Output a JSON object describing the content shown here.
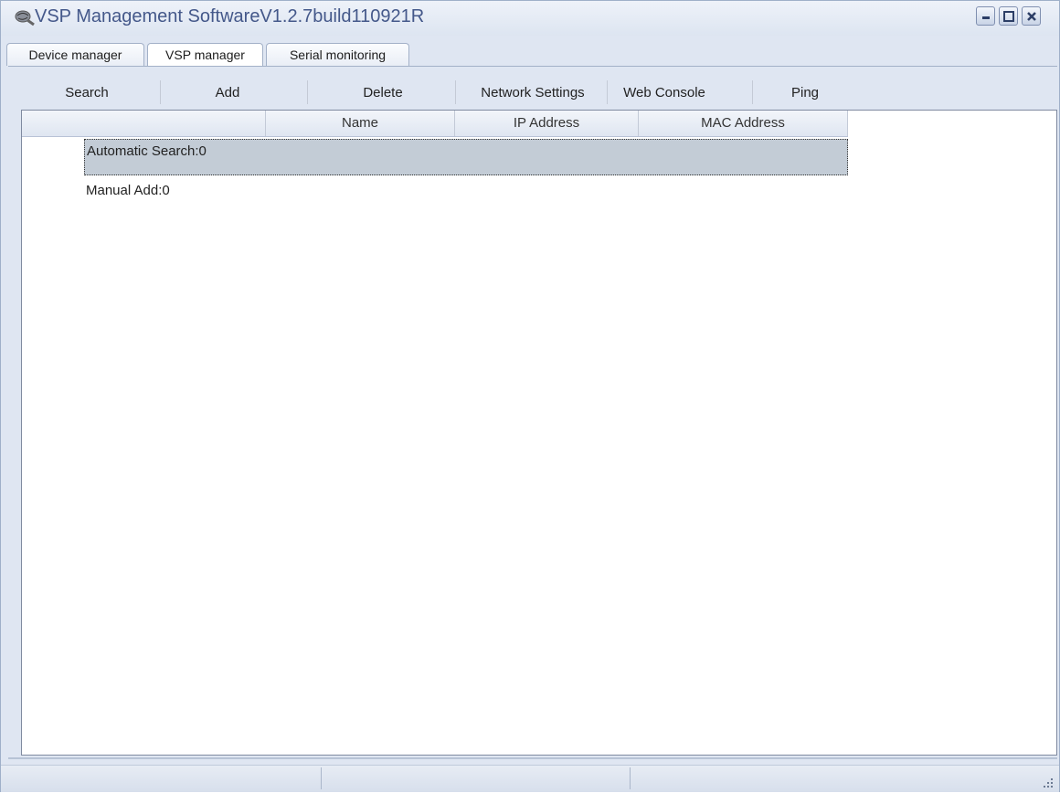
{
  "window": {
    "title": "VSP Management SoftwareV1.2.7build110921R",
    "icons": {
      "app": "network-globe-icon",
      "minimize": "minimize-icon",
      "maximize": "maximize-icon",
      "close": "close-icon"
    }
  },
  "tabs": [
    {
      "label": "Device manager",
      "active": false
    },
    {
      "label": "VSP manager",
      "active": true
    },
    {
      "label": "Serial monitoring",
      "active": false
    }
  ],
  "toolbar": {
    "search": "Search",
    "add": "Add",
    "delete": "Delete",
    "network_settings": "Network Settings",
    "web_console": "Web Console",
    "ping": "Ping"
  },
  "table": {
    "columns": [
      "",
      "Name",
      "IP Address",
      "MAC Address"
    ],
    "groups": [
      {
        "label": "Automatic Search:0",
        "selected": true
      },
      {
        "label": "Manual Add:0",
        "selected": false
      }
    ]
  },
  "statusbar": {
    "panels": [
      "",
      "",
      ""
    ]
  },
  "colors": {
    "title_text": "#44588a",
    "selection": "#c3ccd6",
    "frame": "#dfe6f2"
  }
}
